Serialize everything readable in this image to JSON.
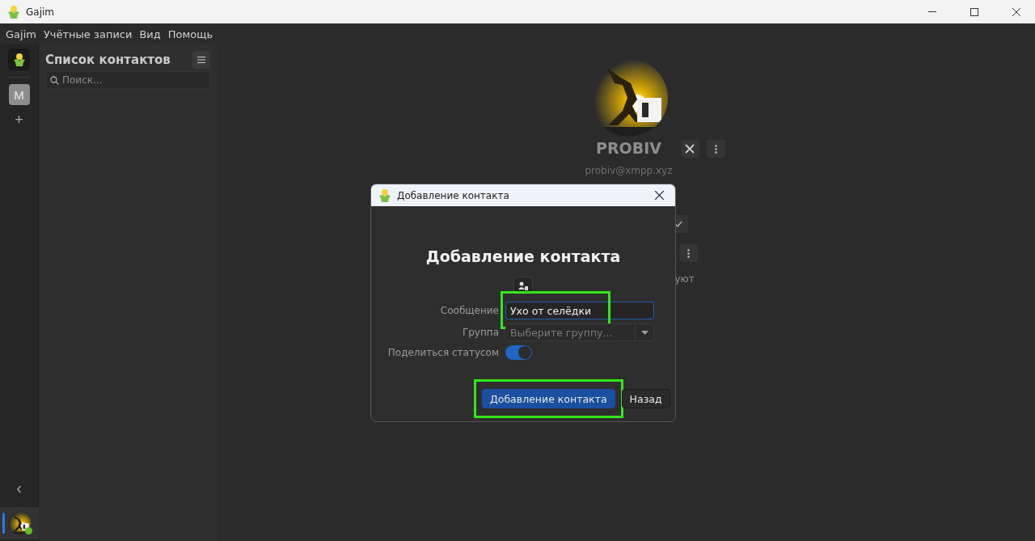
{
  "window": {
    "title": "Gajim"
  },
  "menu": [
    "Gajim",
    "Учётные записи",
    "Вид",
    "Помощь"
  ],
  "rail": {
    "account_initial": "M",
    "add": "+",
    "collapse": "‹"
  },
  "contacts": {
    "title": "Список контактов",
    "search": {
      "placeholder": "Поиск..."
    }
  },
  "profile": {
    "name": "PROBIV",
    "address": "probiv@xmpp.xyz",
    "partial_text": "уют"
  },
  "dialog": {
    "title": "Добавление контакта",
    "heading": "Добавление контакта",
    "fields": [
      {
        "kind": "text",
        "label": "Сообщение",
        "value": "Ухо от селёдки",
        "highlighted": true
      },
      {
        "kind": "dropdown",
        "label": "Группа",
        "placeholder": "Выберите группу..."
      },
      {
        "kind": "switch",
        "label": "Поделиться статусом",
        "on": true
      }
    ],
    "buttons": [
      {
        "label": "Добавление контакта",
        "primary": true,
        "highlighted": true
      },
      {
        "label": "Назад",
        "primary": false,
        "highlighted": false
      }
    ]
  }
}
